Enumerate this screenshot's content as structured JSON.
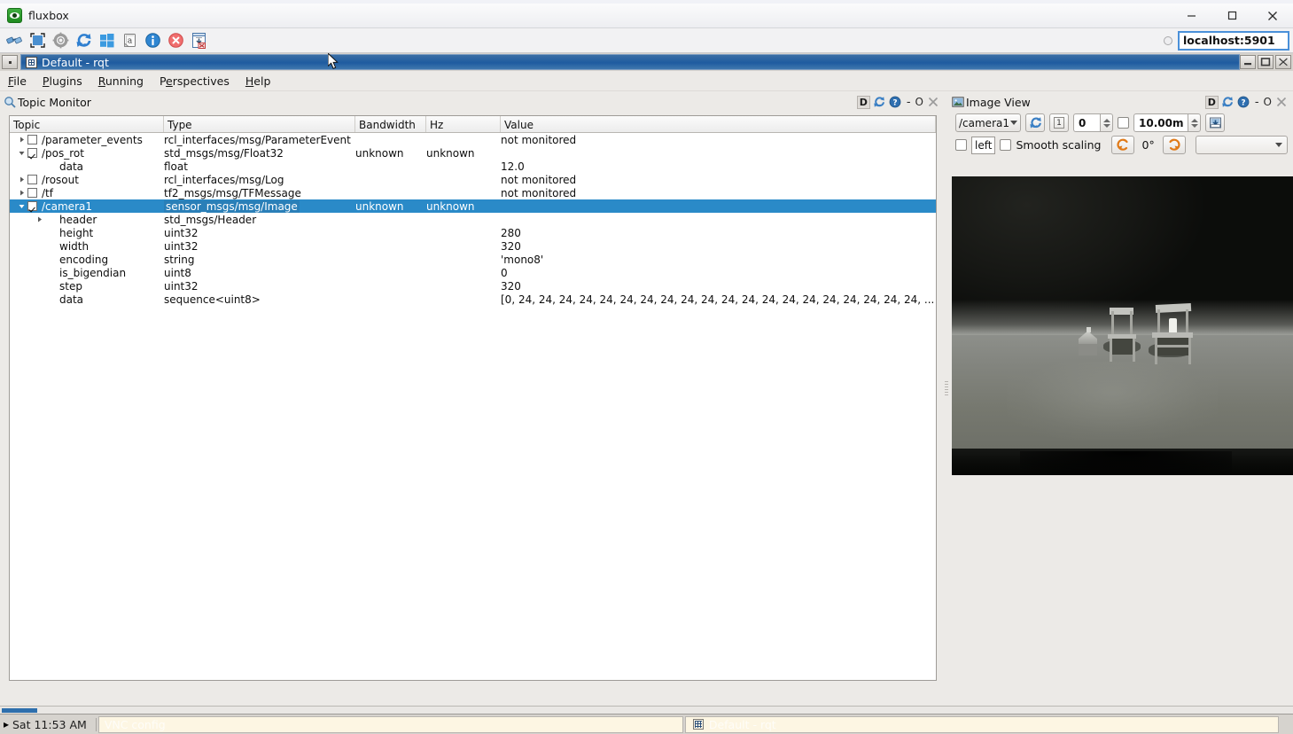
{
  "vnc_window": {
    "title": "fluxbox",
    "app_icon": "vnc-eye-icon",
    "address_value": "localhost:5901",
    "toolbar_icons": [
      {
        "name": "connect-icon",
        "label": "Connect"
      },
      {
        "name": "fullscreen-icon",
        "label": "Full screen"
      },
      {
        "name": "options-gear-icon",
        "label": "Options"
      },
      {
        "name": "refresh-icon",
        "label": "Refresh"
      },
      {
        "name": "windows-key-icon",
        "label": "Send Windows key"
      },
      {
        "name": "clipboard-icon",
        "label": "Clipboard"
      },
      {
        "name": "info-icon",
        "label": "Connection info"
      },
      {
        "name": "disconnect-icon",
        "label": "Disconnect"
      },
      {
        "name": "ctrl-alt-del-icon",
        "label": "Send Ctrl-Alt-Del"
      }
    ],
    "window_buttons": [
      {
        "name": "minimize-button",
        "glyph": "–"
      },
      {
        "name": "maximize-button",
        "glyph": "□"
      },
      {
        "name": "close-button",
        "glyph": "✕"
      }
    ],
    "ghost_top_text": "················"
  },
  "rqt_window": {
    "title": "Default - rqt",
    "icon": "rqt-grid-icon",
    "window_buttons": [
      {
        "name": "fb-minimize-button",
        "glyph": "_"
      },
      {
        "name": "fb-maximize-button",
        "glyph": "□"
      },
      {
        "name": "fb-close-button",
        "glyph": "✕"
      }
    ]
  },
  "menubar": {
    "items": [
      {
        "name": "menu-file",
        "label": "File",
        "mnemonic": "F"
      },
      {
        "name": "menu-plugins",
        "label": "Plugins",
        "mnemonic": "P"
      },
      {
        "name": "menu-running",
        "label": "Running",
        "mnemonic": "R"
      },
      {
        "name": "menu-perspectives",
        "label": "Perspectives",
        "mnemonic": "P"
      },
      {
        "name": "menu-help",
        "label": "Help",
        "mnemonic": "H"
      }
    ]
  },
  "topic_monitor": {
    "title": "Topic Monitor",
    "icon": "magnifier-icon",
    "header_buttons": {
      "dock": "D",
      "reload": "reload-icon",
      "help": "help-icon",
      "minimize": "-",
      "float": "O",
      "close": "✕"
    },
    "columns": [
      "Topic",
      "Type",
      "Bandwidth",
      "Hz",
      "Value"
    ],
    "rows": [
      {
        "indent": 0,
        "arrow": "collapsed",
        "check": "unchecked",
        "topic": "/parameter_events",
        "type": "rcl_interfaces/msg/ParameterEvent",
        "bandwidth": "",
        "hz": "",
        "value": "not monitored"
      },
      {
        "indent": 0,
        "arrow": "expanded",
        "check": "checked",
        "topic": "/pos_rot",
        "type": "std_msgs/msg/Float32",
        "bandwidth": "unknown",
        "hz": "unknown",
        "value": ""
      },
      {
        "indent": 1,
        "arrow": "none",
        "check": "none",
        "topic": "data",
        "type": "float",
        "bandwidth": "",
        "hz": "",
        "value": "12.0"
      },
      {
        "indent": 0,
        "arrow": "collapsed",
        "check": "unchecked",
        "topic": "/rosout",
        "type": "rcl_interfaces/msg/Log",
        "bandwidth": "",
        "hz": "",
        "value": "not monitored"
      },
      {
        "indent": 0,
        "arrow": "collapsed",
        "check": "unchecked",
        "topic": "/tf",
        "type": "tf2_msgs/msg/TFMessage",
        "bandwidth": "",
        "hz": "",
        "value": "not monitored"
      },
      {
        "indent": 0,
        "arrow": "expanded",
        "check": "checked",
        "topic": "/camera1",
        "type": "sensor_msgs/msg/Image",
        "bandwidth": "unknown",
        "hz": "unknown",
        "value": "",
        "selected": true
      },
      {
        "indent": 1,
        "arrow": "collapsed",
        "check": "none",
        "topic": "header",
        "type": "std_msgs/Header",
        "bandwidth": "",
        "hz": "",
        "value": ""
      },
      {
        "indent": 1,
        "arrow": "none",
        "check": "none",
        "topic": "height",
        "type": "uint32",
        "bandwidth": "",
        "hz": "",
        "value": "280"
      },
      {
        "indent": 1,
        "arrow": "none",
        "check": "none",
        "topic": "width",
        "type": "uint32",
        "bandwidth": "",
        "hz": "",
        "value": "320"
      },
      {
        "indent": 1,
        "arrow": "none",
        "check": "none",
        "topic": "encoding",
        "type": "string",
        "bandwidth": "",
        "hz": "",
        "value": "'mono8'"
      },
      {
        "indent": 1,
        "arrow": "none",
        "check": "none",
        "topic": "is_bigendian",
        "type": "uint8",
        "bandwidth": "",
        "hz": "",
        "value": "0"
      },
      {
        "indent": 1,
        "arrow": "none",
        "check": "none",
        "topic": "step",
        "type": "uint32",
        "bandwidth": "",
        "hz": "",
        "value": "320"
      },
      {
        "indent": 1,
        "arrow": "none",
        "check": "none",
        "topic": "data",
        "type": "sequence<uint8>",
        "bandwidth": "",
        "hz": "",
        "value": "[0, 24, 24, 24, 24, 24, 24, 24, 24, 24, 24, 24, 24, 24, 24, 24, 24, 24, 24, 24, 24, ..."
      }
    ]
  },
  "image_view": {
    "title": "Image View",
    "icon": "picture-icon",
    "header_buttons": {
      "dock": "D",
      "reload": "reload-icon",
      "help": "help-icon",
      "minimize": "-",
      "float": "O",
      "close": "✕"
    },
    "topic_combo_value": "/camera1",
    "refresh_icon": "refresh-topics-icon",
    "numbered_button": "1",
    "index_spin_value": "0",
    "dynamic_range_checkbox": false,
    "max_range_value": "10.00m",
    "save_icon": "save-image-icon",
    "publish_checkbox": false,
    "mouse_topic_value": "left",
    "smooth_scaling_label": "Smooth scaling",
    "smooth_scaling_checked": false,
    "rotate_left_icon": "rotate-left-icon",
    "rotation_label": "0°",
    "rotate_right_icon": "rotate-right-icon",
    "extra_combo_value": ""
  },
  "taskbar": {
    "workspace_arrow": "▸",
    "clock": "Sat 11:53 AM",
    "slots": [
      {
        "name": "taskbar-item-vnc-config",
        "label": "VNC config",
        "icon": false
      },
      {
        "name": "taskbar-item-rqt",
        "label": "Default - rqt",
        "icon": true
      }
    ]
  },
  "colors": {
    "selection_blue": "#2a8ac8",
    "titlebar_blue": "#1f5ca0",
    "accent_orange": "#e07a18",
    "taskbar_cream": "#fdf6e3",
    "panel_bg": "#eceae7"
  }
}
